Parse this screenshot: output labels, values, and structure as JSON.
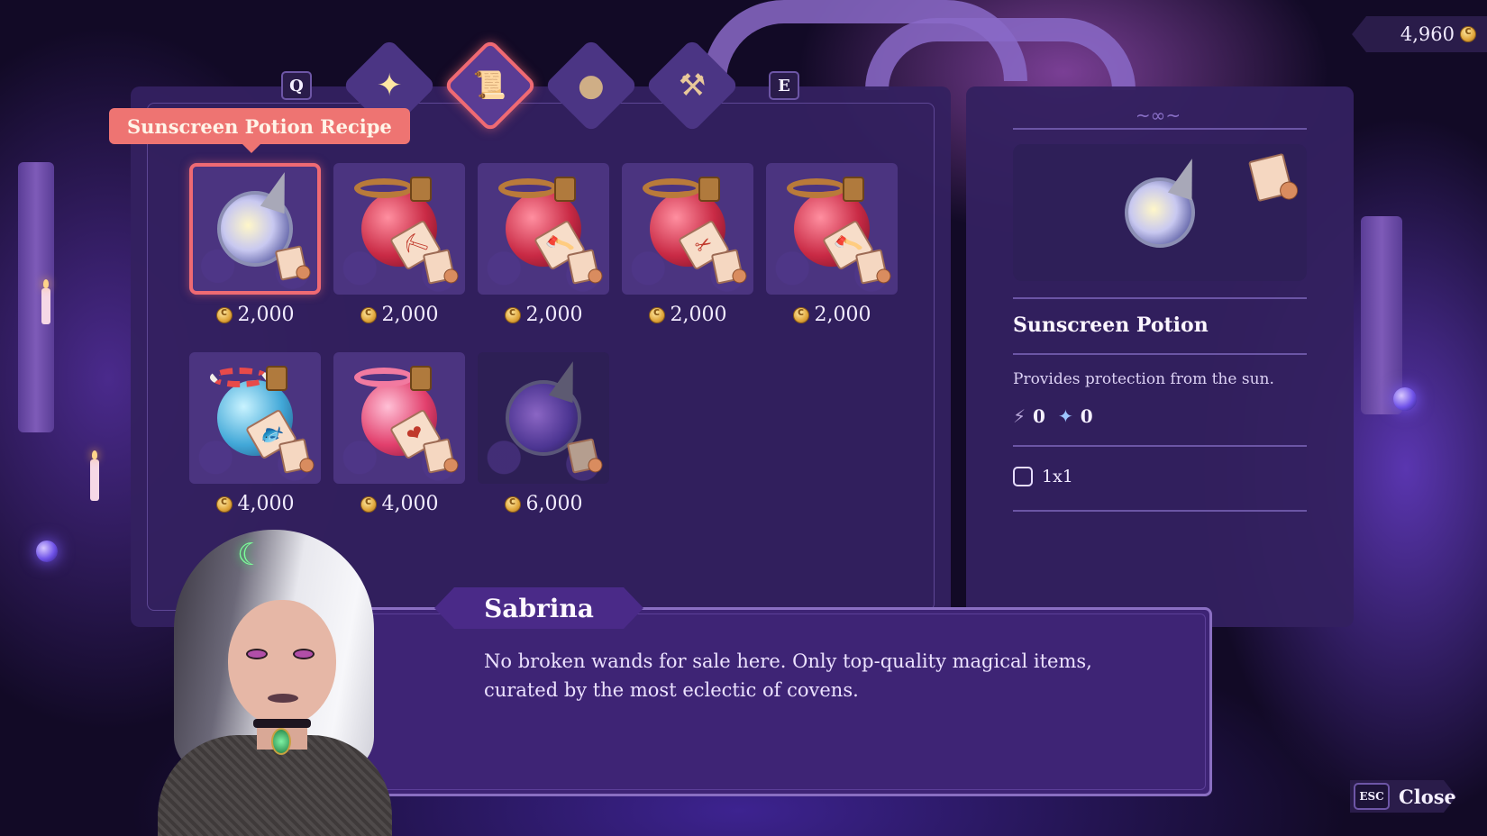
{
  "currency": {
    "amount": "4,960",
    "icon": "coin-icon"
  },
  "tabs": {
    "prev_key": "Q",
    "next_key": "E",
    "items": [
      {
        "name": "sparkles",
        "icon": "sparkles-icon",
        "glyph": "✦",
        "active": false
      },
      {
        "name": "recipes",
        "icon": "recipe-scroll-icon",
        "glyph": "📜",
        "active": true
      },
      {
        "name": "ingredients",
        "icon": "ingredient-sack-icon",
        "glyph": "●",
        "active": false
      },
      {
        "name": "tools",
        "icon": "hammer-icon",
        "glyph": "⚒",
        "active": false
      }
    ]
  },
  "tooltip": "Sunscreen Potion Recipe",
  "shop_items": [
    {
      "price": "2,000",
      "potion": "sun",
      "selected": true,
      "tag_glyph": ""
    },
    {
      "price": "2,000",
      "potion": "red",
      "selected": false,
      "tag_glyph": "⛏"
    },
    {
      "price": "2,000",
      "potion": "red",
      "selected": false,
      "tag_glyph": "🪓"
    },
    {
      "price": "2,000",
      "potion": "red",
      "selected": false,
      "tag_glyph": "✂"
    },
    {
      "price": "2,000",
      "potion": "red",
      "selected": false,
      "tag_glyph": "🪓"
    },
    {
      "price": "4,000",
      "potion": "blue",
      "selected": false,
      "tag_glyph": "🐟"
    },
    {
      "price": "4,000",
      "potion": "pink",
      "selected": false,
      "tag_glyph": "❤"
    },
    {
      "price": "6,000",
      "potion": "dark",
      "selected": false,
      "tag_glyph": ""
    }
  ],
  "details": {
    "name": "Sunscreen Potion",
    "description": "Provides protection from the sun.",
    "stat_energy": "0",
    "stat_magic": "0",
    "size": "1x1"
  },
  "dialogue": {
    "speaker": "Sabrina",
    "text": "No broken wands for sale here. Only top-quality magical items, curated by the most eclectic of covens."
  },
  "close": {
    "key": "ESC",
    "label": "Close"
  },
  "colors": {
    "accent": "#ef6a73",
    "panel": "#342160",
    "background": "#120a26"
  }
}
